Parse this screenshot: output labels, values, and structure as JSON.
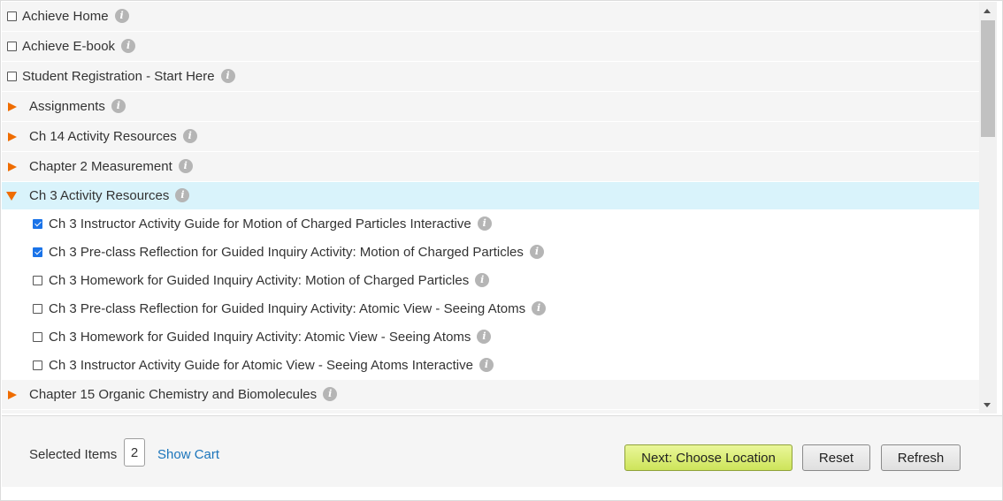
{
  "tree": {
    "top_items": [
      {
        "label": "Achieve Home",
        "checked": false
      },
      {
        "label": "Achieve E-book",
        "checked": false
      },
      {
        "label": "Student Registration - Start Here",
        "checked": false
      }
    ],
    "folders": [
      {
        "label": "Assignments",
        "expanded": false
      },
      {
        "label": "Ch 14 Activity Resources",
        "expanded": false
      },
      {
        "label": "Chapter 2 Measurement",
        "expanded": false
      },
      {
        "label": "Ch 3 Activity Resources",
        "expanded": true
      }
    ],
    "children": [
      {
        "label": "Ch 3 Instructor Activity Guide for Motion of Charged Particles Interactive",
        "checked": true
      },
      {
        "label": "Ch 3 Pre-class Reflection for Guided Inquiry Activity: Motion of Charged Particles",
        "checked": true
      },
      {
        "label": "Ch 3 Homework for Guided Inquiry Activity: Motion of Charged Particles",
        "checked": false
      },
      {
        "label": "Ch 3 Pre-class Reflection for Guided Inquiry Activity: Atomic View - Seeing Atoms",
        "checked": false
      },
      {
        "label": "Ch 3 Homework for Guided Inquiry Activity: Atomic View - Seeing Atoms",
        "checked": false
      },
      {
        "label": "Ch 3 Instructor Activity Guide for Atomic View - Seeing Atoms Interactive",
        "checked": false
      }
    ],
    "last_folder": {
      "label": "Chapter 15 Organic Chemistry and Biomolecules",
      "expanded": false
    },
    "info_glyph": "i"
  },
  "footer": {
    "selected_label": "Selected Items",
    "selected_count": "2",
    "show_cart": "Show Cart",
    "next_button": "Next: Choose Location",
    "reset_button": "Reset",
    "refresh_button": "Refresh"
  },
  "icons": {
    "folder_arrow": "triangle-arrow-icon",
    "info": "info-icon"
  },
  "colors": {
    "accent_orange": "#ef6c00",
    "expanded_row": "#d9f3fb",
    "link_blue": "#1b75bb",
    "next_button": "#d8ee6f",
    "checkbox_checked": "#1a73e8"
  }
}
